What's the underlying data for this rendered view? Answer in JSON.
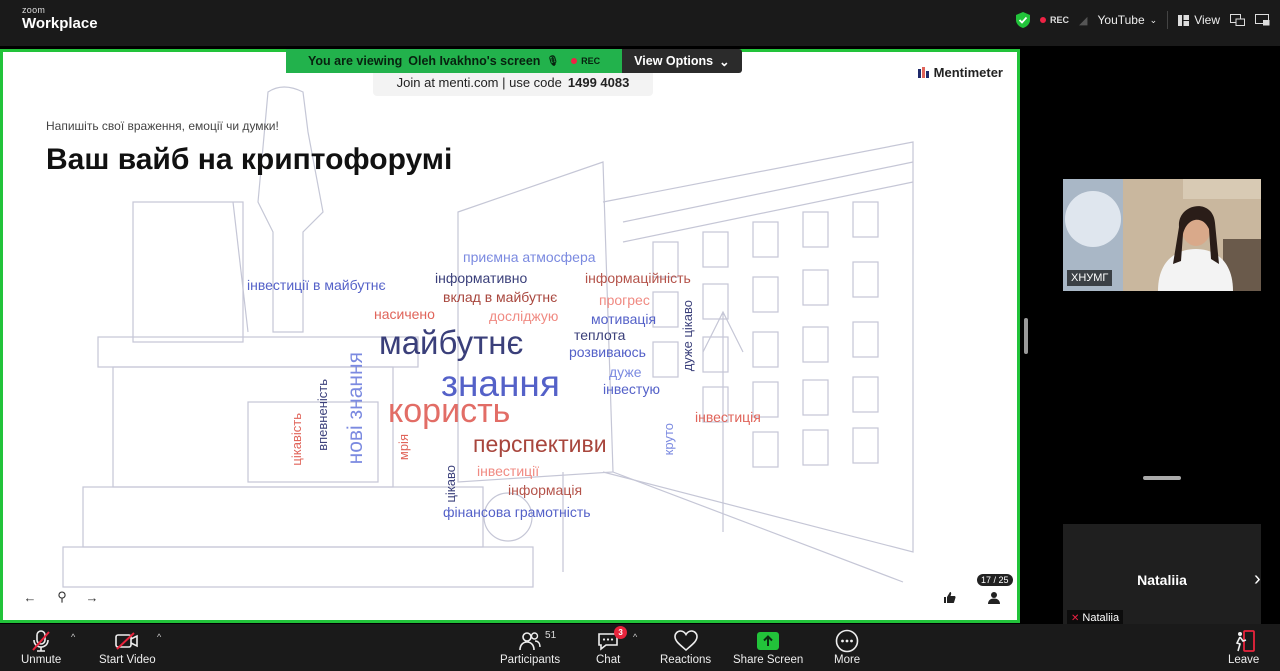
{
  "app": {
    "brand_small": "zoom",
    "brand_big": "Workplace"
  },
  "topbar": {
    "rec_label": "REC",
    "youtube_label": "YouTube",
    "view_label": "View"
  },
  "banner": {
    "viewing_prefix": "You are viewing",
    "presenter": "Oleh Ivakhno's screen",
    "rec_label": "REC",
    "view_options": "View Options"
  },
  "slide": {
    "join_text": "Join at menti.com | use code",
    "code": "1499 4083",
    "brand": "Mentimeter",
    "subtitle": "Напишіть свої враження, емоції чи думки!",
    "title": "Ваш вайб на криптофорумі",
    "counter": "17 / 25",
    "words": [
      {
        "text": "приємна атмосфера",
        "color": "#7b8ae0",
        "size": 14,
        "rotate": false
      },
      {
        "text": "інформативно",
        "color": "#3a3f7a",
        "size": 14,
        "rotate": false
      },
      {
        "text": "інформаційність",
        "color": "#b4534a",
        "size": 14,
        "rotate": false
      },
      {
        "text": "інвестиції в майбутнє",
        "color": "#5461c8",
        "size": 14,
        "rotate": false
      },
      {
        "text": "вклад в майбутнє",
        "color": "#a8463d",
        "size": 14,
        "rotate": false
      },
      {
        "text": "прогрес",
        "color": "#f08a82",
        "size": 14,
        "rotate": false
      },
      {
        "text": "насичено",
        "color": "#e0645a",
        "size": 14,
        "rotate": false
      },
      {
        "text": "досліджую",
        "color": "#f08a82",
        "size": 14,
        "rotate": false
      },
      {
        "text": "мотивація",
        "color": "#5461c8",
        "size": 14,
        "rotate": false
      },
      {
        "text": "дуже цікаво",
        "color": "#3a3f7a",
        "size": 13,
        "rotate": true
      },
      {
        "text": "майбутнє",
        "color": "#3a3f7a",
        "size": 33,
        "rotate": false
      },
      {
        "text": "теплота",
        "color": "#3a3f7a",
        "size": 14,
        "rotate": false
      },
      {
        "text": "розвиваюсь",
        "color": "#5461c8",
        "size": 14,
        "rotate": false
      },
      {
        "text": "нові знання",
        "color": "#7b8ae0",
        "size": 21,
        "rotate": true
      },
      {
        "text": "знання",
        "color": "#5461c8",
        "size": 37,
        "rotate": false
      },
      {
        "text": "дуже",
        "color": "#7b8ae0",
        "size": 14,
        "rotate": false
      },
      {
        "text": "впевненість",
        "color": "#3a3f7a",
        "size": 13,
        "rotate": true
      },
      {
        "text": "інвестую",
        "color": "#5461c8",
        "size": 14,
        "rotate": false
      },
      {
        "text": "цікавість",
        "color": "#e0645a",
        "size": 13,
        "rotate": true
      },
      {
        "text": "користь",
        "color": "#e26d66",
        "size": 34,
        "rotate": false
      },
      {
        "text": "круто",
        "color": "#7b8ae0",
        "size": 13,
        "rotate": true
      },
      {
        "text": "інвестиція",
        "color": "#e0645a",
        "size": 14,
        "rotate": false
      },
      {
        "text": "мрія",
        "color": "#e0645a",
        "size": 13,
        "rotate": true
      },
      {
        "text": "перспективи",
        "color": "#a8463d",
        "size": 23,
        "rotate": false
      },
      {
        "text": "цікаво",
        "color": "#3a3f7a",
        "size": 13,
        "rotate": true
      },
      {
        "text": "інвестиції",
        "color": "#f08a82",
        "size": 14,
        "rotate": false
      },
      {
        "text": "інформація",
        "color": "#b4534a",
        "size": 14,
        "rotate": false
      },
      {
        "text": "фінансова грамотність",
        "color": "#5461c8",
        "size": 14,
        "rotate": false
      }
    ]
  },
  "participants_panel": {
    "tile1_label": "ХНУМГ",
    "tile2_name": "Nataliia",
    "tile2_label": "Nataliia"
  },
  "toolbar": {
    "unmute": "Unmute",
    "start_video": "Start Video",
    "participants": "Participants",
    "participants_count": "51",
    "chat": "Chat",
    "chat_badge": "3",
    "reactions": "Reactions",
    "share": "Share Screen",
    "more": "More",
    "leave": "Leave"
  }
}
